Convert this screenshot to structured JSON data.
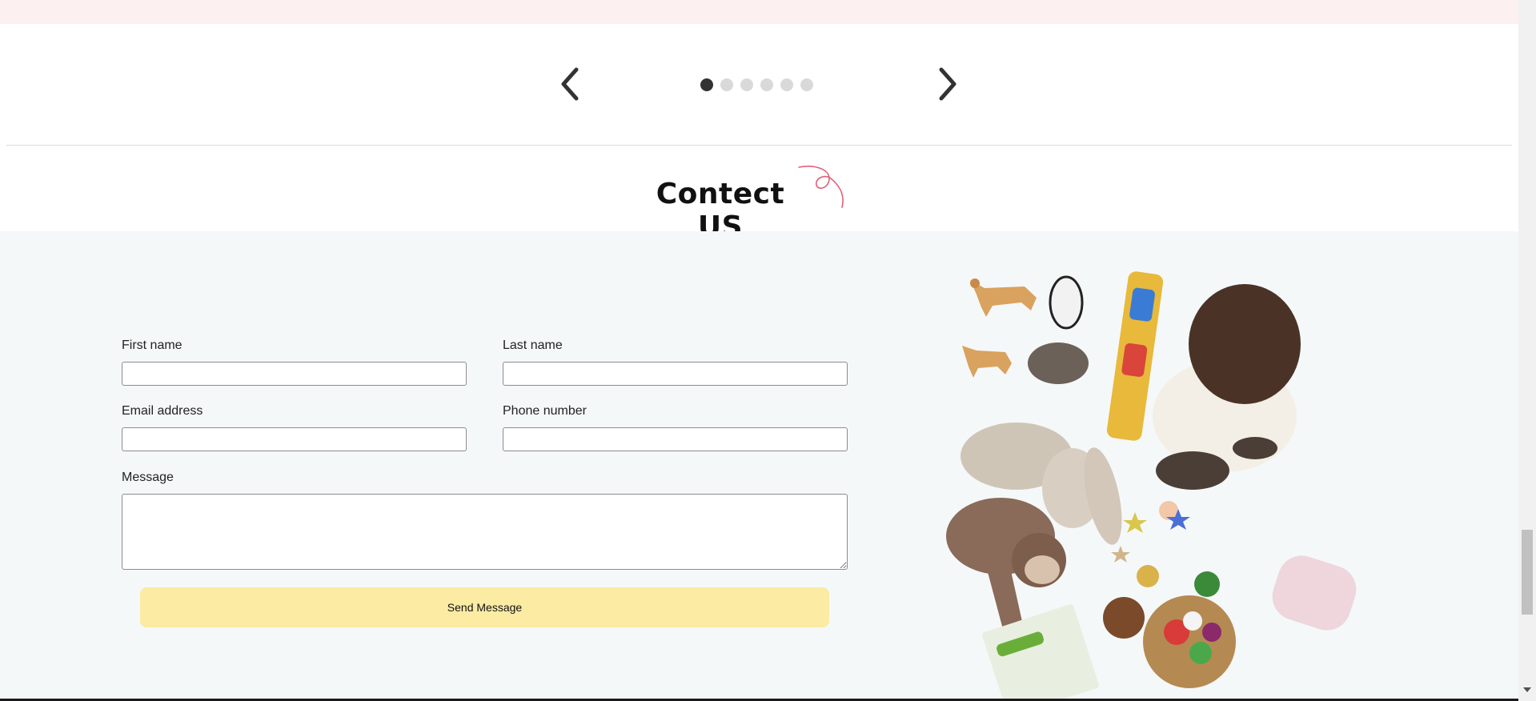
{
  "carousel": {
    "prev_icon": "chevron-left-icon",
    "next_icon": "chevron-right-icon",
    "dot_count": 6,
    "active_dot": 1
  },
  "section": {
    "title": "Contect US"
  },
  "form": {
    "first_name_label": "First name",
    "last_name_label": "Last name",
    "email_label": "Email address",
    "phone_label": "Phone number",
    "message_label": "Message",
    "first_name_value": "",
    "last_name_value": "",
    "email_value": "",
    "phone_value": "",
    "message_value": "",
    "submit_label": "Send Message"
  },
  "colors": {
    "top_band": "#fdf0f0",
    "contact_bg": "#f5f8f9",
    "button_bg": "#fbeba3",
    "dot_active": "#333333",
    "dot_inactive": "#d9d9d9",
    "swirl": "#e0607a"
  }
}
